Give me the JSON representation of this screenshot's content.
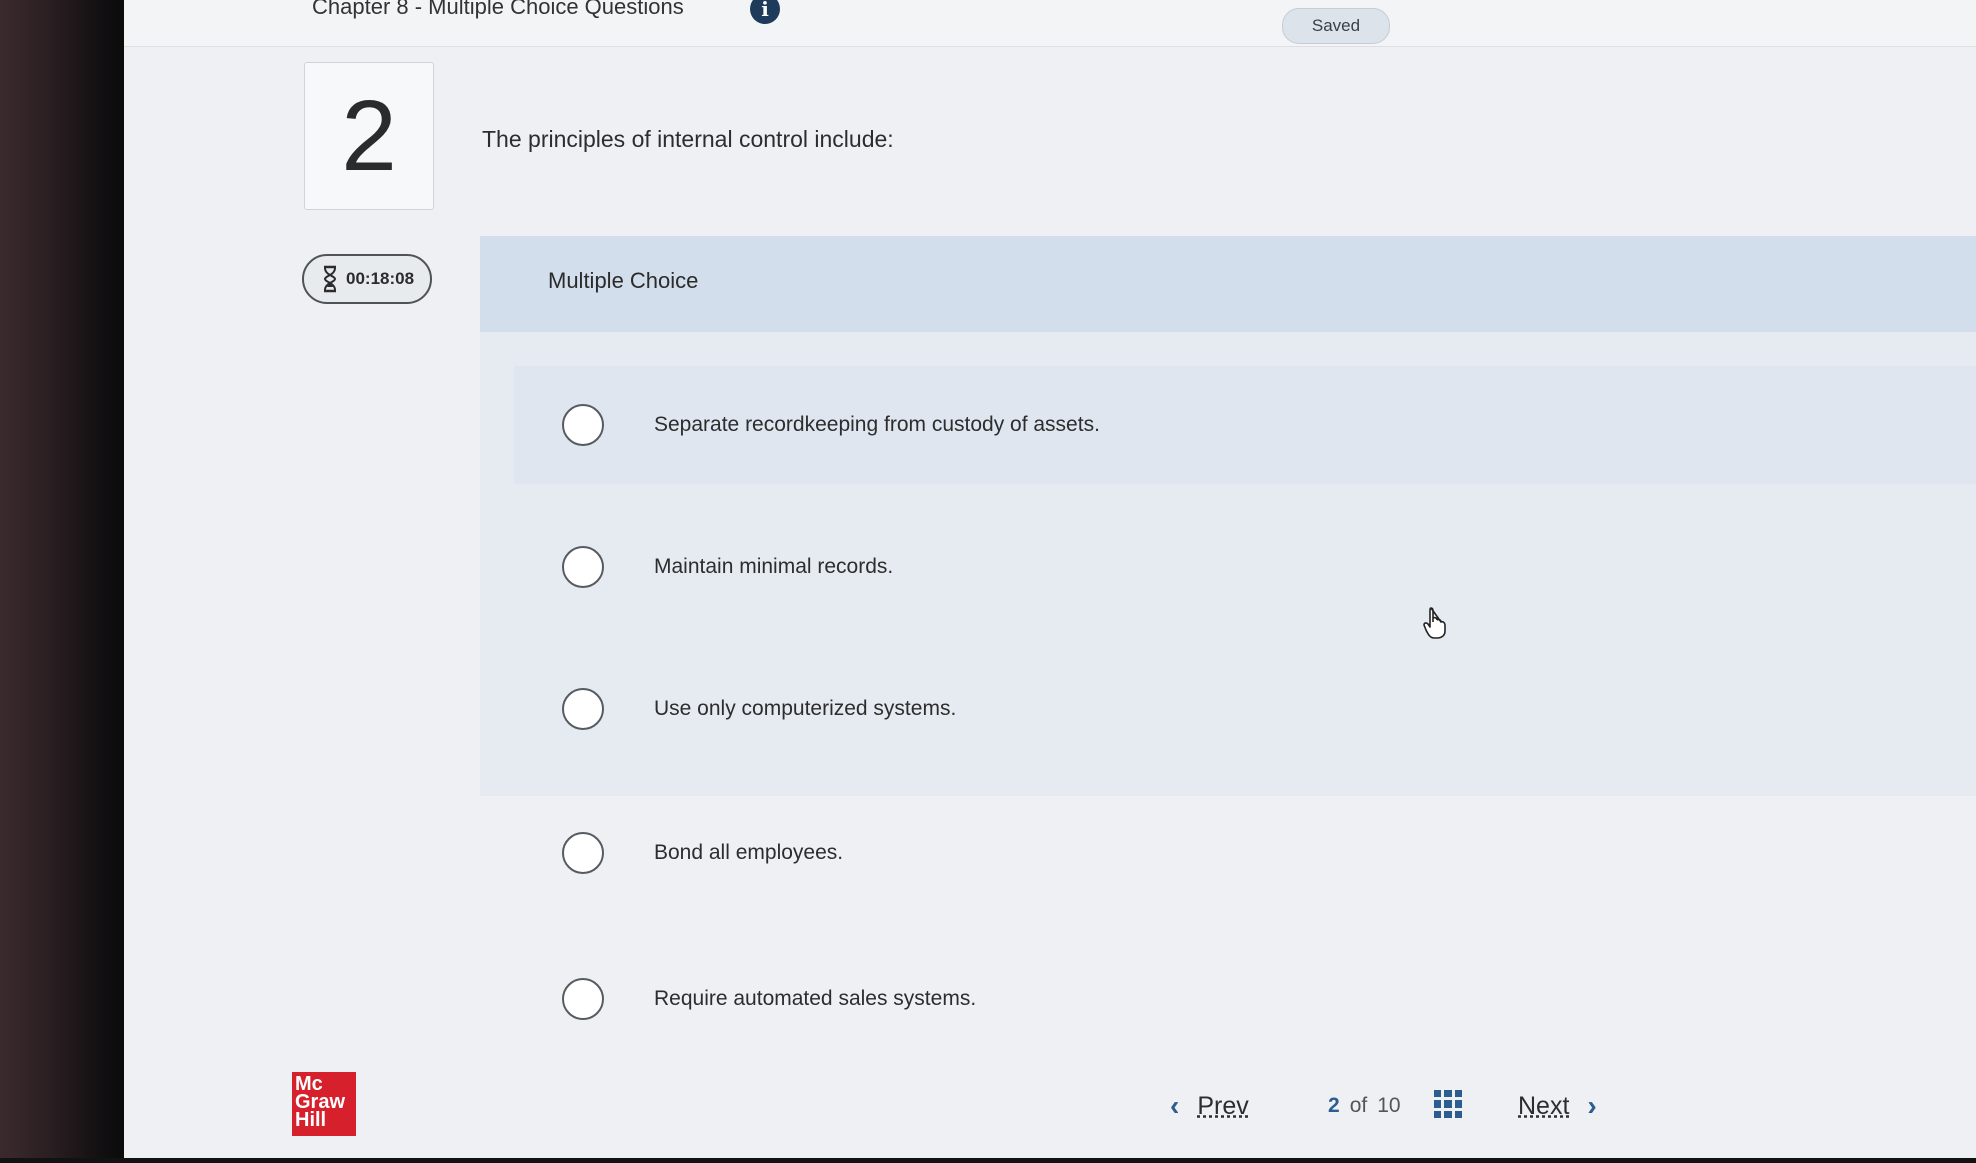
{
  "header": {
    "chapter_title": "Chapter 8 - Multiple Choice Questions",
    "info_glyph": "i",
    "saved_label": "Saved"
  },
  "question": {
    "number": "2",
    "text": "The principles of internal control include:",
    "type_label": "Multiple Choice"
  },
  "timer": {
    "value": "00:18:08"
  },
  "options": [
    {
      "label": "Separate recordkeeping from custody of assets."
    },
    {
      "label": "Maintain minimal records."
    },
    {
      "label": "Use only computerized systems."
    },
    {
      "label": "Bond all employees."
    },
    {
      "label": "Require automated sales systems."
    }
  ],
  "logo": {
    "line1": "Mc",
    "line2": "Graw",
    "line3": "Hill"
  },
  "footer": {
    "prev_label": "Prev",
    "current_page": "2",
    "of_label": "of",
    "total_pages": "10",
    "next_label": "Next"
  },
  "colors": {
    "accent": "#2d5d8f",
    "logo_red": "#d6202c",
    "info_icon": "#1f3b5c"
  },
  "icons": [
    "info-icon",
    "hourglass-icon",
    "grid-icon",
    "chevron-left-icon",
    "chevron-right-icon",
    "hand-cursor-icon"
  ]
}
